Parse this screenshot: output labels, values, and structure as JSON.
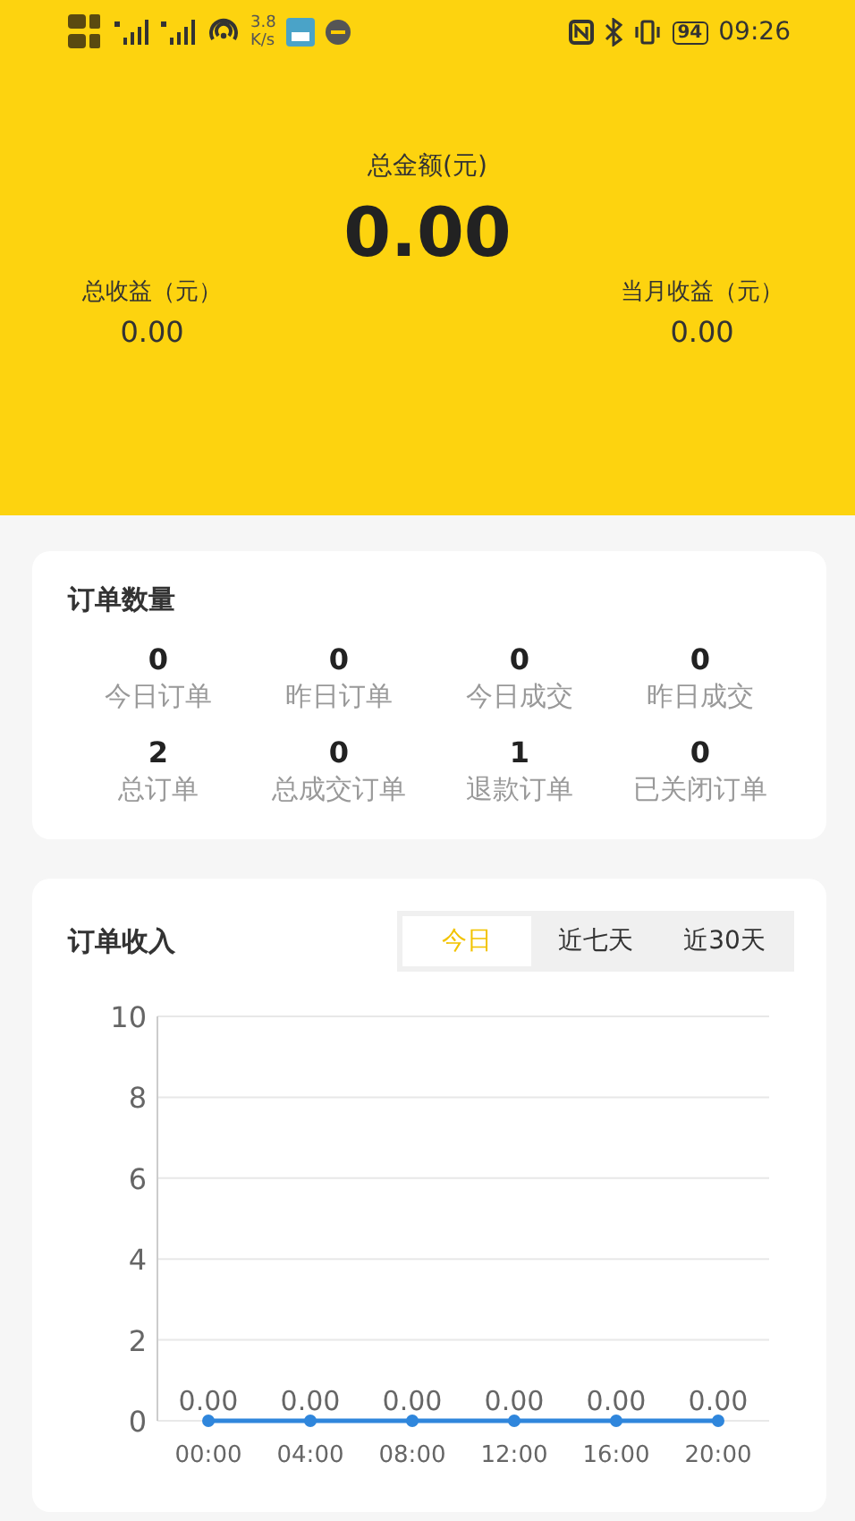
{
  "status_bar": {
    "speed_value": "3.8",
    "speed_unit": "K/s",
    "battery": "94",
    "time": "09:26"
  },
  "summary": {
    "total_label": "总金额(元)",
    "total_value": "0.00",
    "stats": [
      {
        "label": "总收益（元）",
        "value": "0.00"
      },
      {
        "label": "当月收益（元）",
        "value": "0.00"
      }
    ]
  },
  "orders": {
    "title": "订单数量",
    "items": [
      {
        "value": "0",
        "label": "今日订单"
      },
      {
        "value": "0",
        "label": "昨日订单"
      },
      {
        "value": "0",
        "label": "今日成交"
      },
      {
        "value": "0",
        "label": "昨日成交"
      },
      {
        "value": "2",
        "label": "总订单"
      },
      {
        "value": "0",
        "label": "总成交订单"
      },
      {
        "value": "1",
        "label": "退款订单"
      },
      {
        "value": "0",
        "label": "已关闭订单"
      }
    ]
  },
  "income": {
    "title": "订单收入",
    "tabs": [
      {
        "label": "今日",
        "selected": true
      },
      {
        "label": "近七天",
        "selected": false
      },
      {
        "label": "近30天",
        "selected": false
      }
    ],
    "chart_data": {
      "type": "line",
      "categories": [
        "00:00",
        "04:00",
        "08:00",
        "12:00",
        "16:00",
        "20:00"
      ],
      "grid": true,
      "series": [
        {
          "color": "#2f86dc",
          "marker": true,
          "values": [
            0,
            0,
            0,
            0,
            0,
            0
          ]
        }
      ],
      "ylim": [
        0,
        10
      ],
      "yticks": [
        0,
        2,
        4,
        6,
        8,
        10
      ],
      "value_labels": [
        "0.00",
        "0.00",
        "0.00",
        "0.00",
        "0.00",
        "0.00"
      ]
    }
  }
}
